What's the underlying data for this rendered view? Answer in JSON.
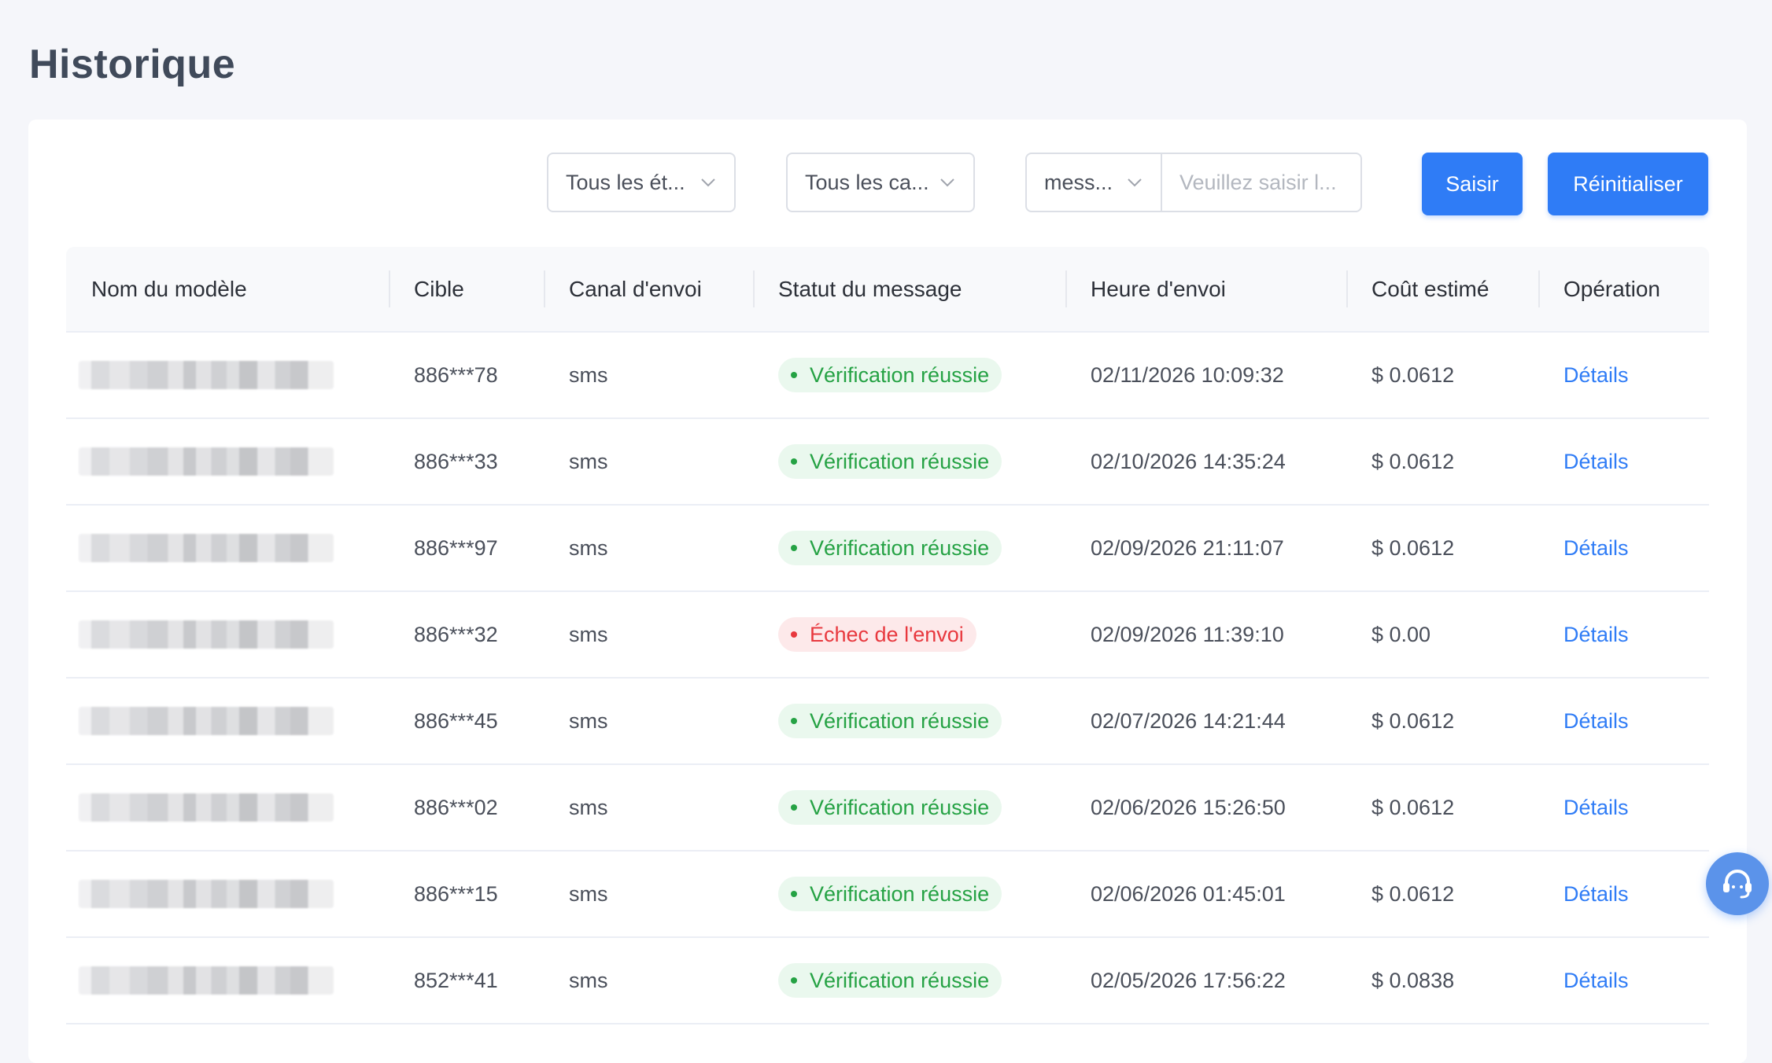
{
  "page": {
    "title": "Historique"
  },
  "filters": {
    "status_select": "Tous les ét...",
    "channel_select": "Tous les ca...",
    "field_select": "mess...",
    "search_placeholder": "Veuillez saisir l...",
    "search_value": "",
    "search_button": "Saisir",
    "reset_button": "Réinitialiser"
  },
  "table": {
    "columns": {
      "name": "Nom du modèle",
      "target": "Cible",
      "channel": "Canal d'envoi",
      "status": "Statut du message",
      "time": "Heure d'envoi",
      "cost": "Coût estimé",
      "operation": "Opération"
    },
    "rows": [
      {
        "target": "886***78",
        "channel": "sms",
        "status": "Vérification réussie",
        "status_type": "success",
        "time": "02/11/2026 10:09:32",
        "cost": "$ 0.0612",
        "action": "Détails"
      },
      {
        "target": "886***33",
        "channel": "sms",
        "status": "Vérification réussie",
        "status_type": "success",
        "time": "02/10/2026 14:35:24",
        "cost": "$ 0.0612",
        "action": "Détails"
      },
      {
        "target": "886***97",
        "channel": "sms",
        "status": "Vérification réussie",
        "status_type": "success",
        "time": "02/09/2026 21:11:07",
        "cost": "$ 0.0612",
        "action": "Détails"
      },
      {
        "target": "886***32",
        "channel": "sms",
        "status": "Échec de l'envoi",
        "status_type": "fail",
        "time": "02/09/2026 11:39:10",
        "cost": "$ 0.00",
        "action": "Détails"
      },
      {
        "target": "886***45",
        "channel": "sms",
        "status": "Vérification réussie",
        "status_type": "success",
        "time": "02/07/2026 14:21:44",
        "cost": "$ 0.0612",
        "action": "Détails"
      },
      {
        "target": "886***02",
        "channel": "sms",
        "status": "Vérification réussie",
        "status_type": "success",
        "time": "02/06/2026 15:26:50",
        "cost": "$ 0.0612",
        "action": "Détails"
      },
      {
        "target": "886***15",
        "channel": "sms",
        "status": "Vérification réussie",
        "status_type": "success",
        "time": "02/06/2026 01:45:01",
        "cost": "$ 0.0612",
        "action": "Détails"
      },
      {
        "target": "852***41",
        "channel": "sms",
        "status": "Vérification réussie",
        "status_type": "success",
        "time": "02/05/2026 17:56:22",
        "cost": "$ 0.0838",
        "action": "Détails"
      }
    ]
  },
  "colors": {
    "accent": "#2f7cf6",
    "success": "#25a244",
    "success_bg": "#eaf8ee",
    "fail": "#e8383e",
    "fail_bg": "#fde9ea",
    "background": "#f5f6fa"
  },
  "icons": {
    "dropdown": "chevron-down-icon",
    "support": "headset-icon"
  }
}
